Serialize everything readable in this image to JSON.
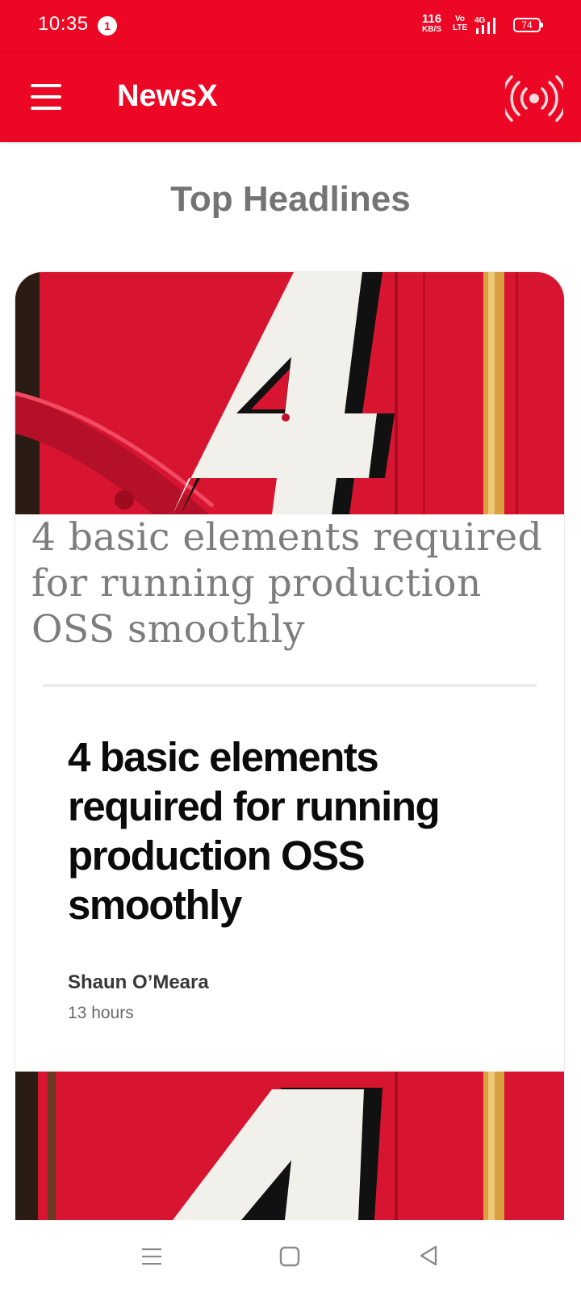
{
  "status_bar": {
    "time": "10:35",
    "notification_count": "1",
    "net_speed_value": "116",
    "net_speed_unit": "KB/S",
    "volte_line1": "Vo",
    "volte_line2": "LTE",
    "network": "4G",
    "battery": "74"
  },
  "app_bar": {
    "title": "NewsX",
    "menu_icon": "hamburger-menu-icon",
    "live_icon": "live-broadcast-icon"
  },
  "section": {
    "title": "Top Headlines"
  },
  "articles": [
    {
      "image_icon": "number-four-photo",
      "headline": "4 basic elements required for running production OSS smoothly",
      "preview_headline": "4 basic elements required for running production OSS smoothly",
      "author": "Shaun O’Meara",
      "published": "13 hours"
    }
  ],
  "nav_bar": {
    "recents_icon": "recents-icon",
    "home_icon": "home-icon",
    "back_icon": "back-icon"
  },
  "colors": {
    "brand": "#EC0824",
    "section_title": "#747474",
    "serif_headline": "#7d7d7d",
    "bold_headline": "#0b0b0b"
  }
}
